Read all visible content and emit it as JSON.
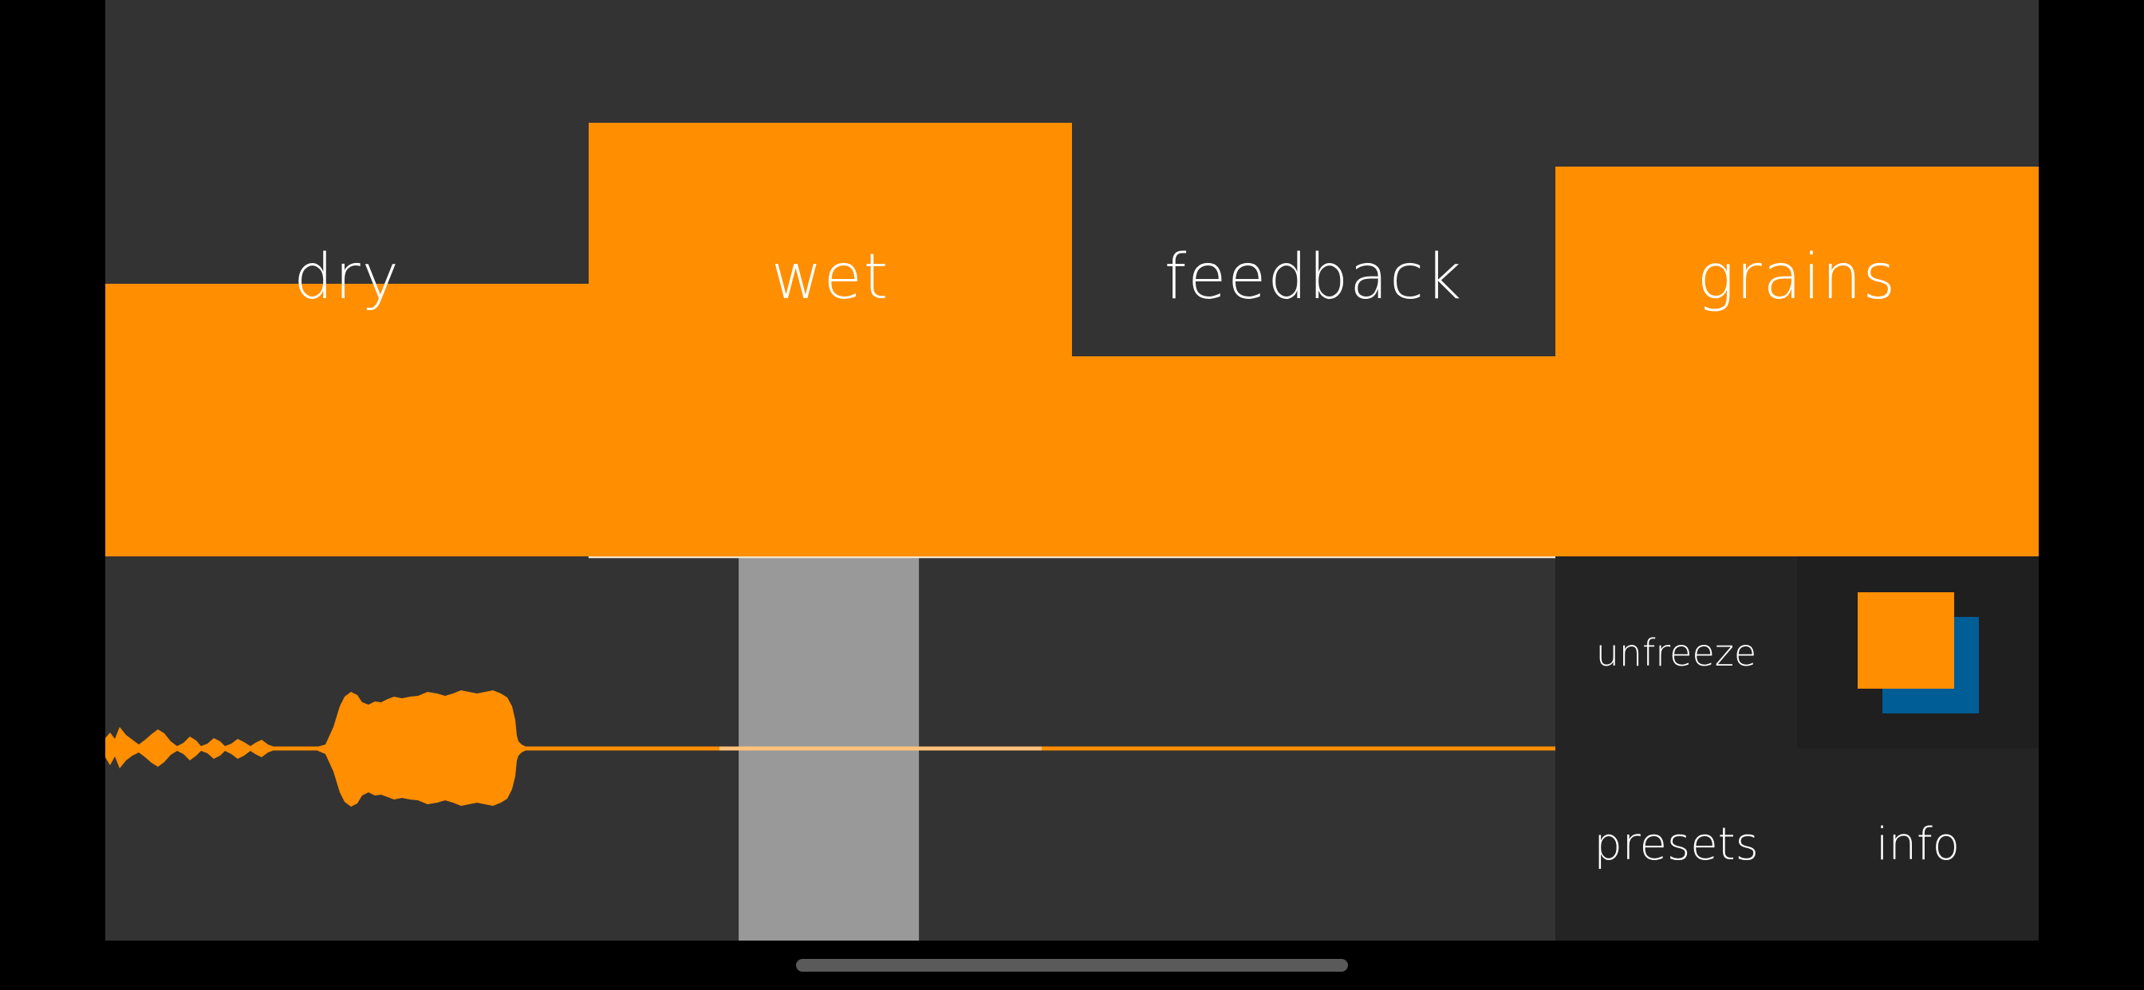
{
  "colors": {
    "accent": "#ff8e00",
    "background": "#333333",
    "panel": "#242424",
    "selection": "#999999",
    "freeze_back": "#005d96",
    "freeze_front": "#ff8e00"
  },
  "faders": [
    {
      "id": "dry",
      "label": "dry",
      "level": 0.49
    },
    {
      "id": "wet",
      "label": "wet",
      "level": 0.78
    },
    {
      "id": "feedback",
      "label": "feedback",
      "level": 0.36
    },
    {
      "id": "grains",
      "label": "grains",
      "level": 0.7
    }
  ],
  "buttons": {
    "unfreeze": "unfreeze",
    "freeze_icon": "freeze-toggle-icon",
    "presets": "presets",
    "info": "info"
  },
  "waveform": {
    "selection_start": 0.4368,
    "selection_end": 0.5611,
    "playhead_region_start": 0.3333,
    "playhead_region_end": 1.0
  }
}
